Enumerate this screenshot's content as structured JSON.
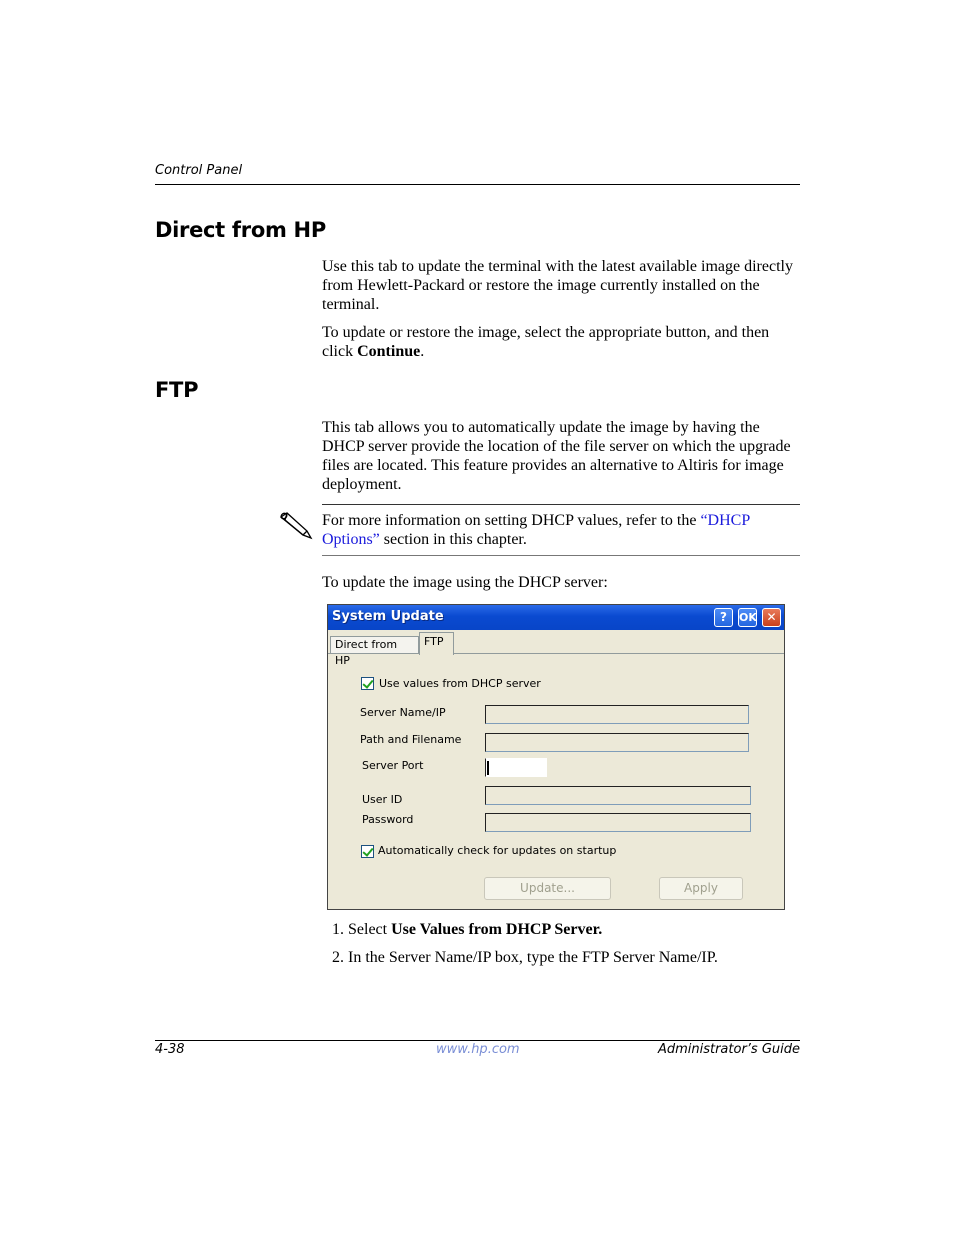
{
  "header": {
    "running_head": "Control Panel"
  },
  "sections": [
    {
      "heading": "Direct from HP",
      "paragraphs": [
        "Use this tab to update the terminal with the latest available image directly from Hewlett-Packard or restore the image currently installed on the terminal.",
        "To update or restore the image, select the appropriate button, and then click"
      ],
      "bold_term": "Continue",
      "trailing": "."
    },
    {
      "heading": "FTP",
      "paragraph": "This tab allows you to automatically update the image by having the DHCP server provide the location of the file server on which the upgrade files are located. This feature provides an alternative to Altiris for image deployment."
    }
  ],
  "note": {
    "icon": "pencil-note-icon",
    "text_before": "For more information on setting DHCP values, refer to the ",
    "link_text": "“DHCP Options”",
    "text_after": " section in this chapter."
  },
  "intro_steps": "To update the image using the DHCP server:",
  "dialog": {
    "title": "System Update",
    "buttons": {
      "help": "?",
      "ok": "OK",
      "close": "✕"
    },
    "tabs": [
      {
        "label": "Direct from HP",
        "active": false
      },
      {
        "label": "FTP",
        "active": true
      }
    ],
    "use_dhcp": {
      "label": "Use values from DHCP server",
      "checked": true
    },
    "fields": [
      {
        "label": "Server Name/IP",
        "value": ""
      },
      {
        "label": "Path and Filename",
        "value": ""
      },
      {
        "label": "Server Port",
        "value": ""
      },
      {
        "label": "User ID",
        "value": ""
      },
      {
        "label": "Password",
        "value": ""
      }
    ],
    "auto_check": {
      "label": "Automatically check for updates on startup",
      "checked": true
    },
    "update_button": "Update...",
    "apply_button": "Apply"
  },
  "steps": [
    {
      "num": "1.",
      "text": "Select ",
      "bold": "Use Values from DHCP Server."
    },
    {
      "num": "2.",
      "text": "In the Server Name/IP box, type the FTP Server Name/IP."
    }
  ],
  "footer": {
    "page": "4-38",
    "url": "www.hp.com",
    "guide": "Administrator’s Guide"
  }
}
